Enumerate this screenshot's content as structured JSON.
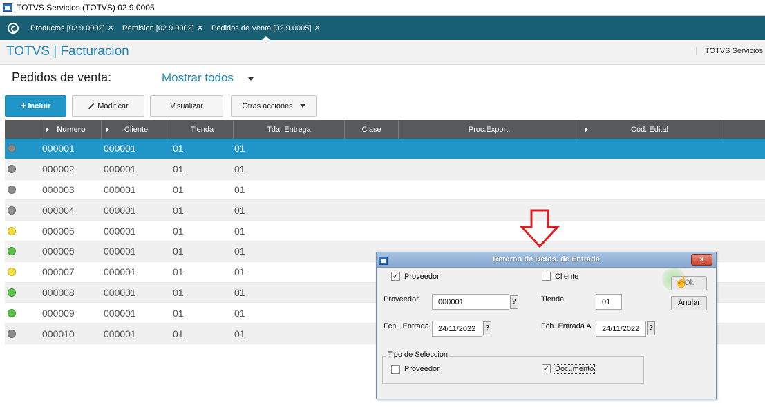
{
  "window": {
    "title": "TOTVS Servicios (TOTVS) 02.9.0005"
  },
  "tabs": [
    {
      "label": "Productos [02.9.0002]",
      "active": false
    },
    {
      "label": "Remision [02.9.0002]",
      "active": false
    },
    {
      "label": "Pedidos de Venta [02.9.0005]",
      "active": true
    }
  ],
  "module": {
    "title": "TOTVS | Facturacion",
    "company": "TOTVS Servicios"
  },
  "page": {
    "title": "Pedidos de venta:",
    "filter": "Mostrar todos"
  },
  "toolbar": {
    "incluir": "Incluir",
    "modificar": "Modificar",
    "visualizar": "Visualizar",
    "otras": "Otras acciones"
  },
  "grid": {
    "columns": [
      "Numero",
      "Cliente",
      "Tienda",
      "Tda. Entrega",
      "Clase",
      "Proc.Export.",
      "Cód. Edital"
    ],
    "rows": [
      {
        "status": "gray",
        "numero": "000001",
        "cliente": "000001",
        "tienda": "01",
        "tda": "01",
        "selected": true
      },
      {
        "status": "gray",
        "numero": "000002",
        "cliente": "000001",
        "tienda": "01",
        "tda": "01"
      },
      {
        "status": "gray",
        "numero": "000003",
        "cliente": "000001",
        "tienda": "01",
        "tda": "01"
      },
      {
        "status": "gray",
        "numero": "000004",
        "cliente": "000001",
        "tienda": "01",
        "tda": "01"
      },
      {
        "status": "yellow",
        "numero": "000005",
        "cliente": "000001",
        "tienda": "01",
        "tda": "01"
      },
      {
        "status": "green",
        "numero": "000006",
        "cliente": "000001",
        "tienda": "01",
        "tda": "01"
      },
      {
        "status": "yellow",
        "numero": "000007",
        "cliente": "000001",
        "tienda": "01",
        "tda": "01"
      },
      {
        "status": "green",
        "numero": "000008",
        "cliente": "000001",
        "tienda": "01",
        "tda": "01"
      },
      {
        "status": "green",
        "numero": "000009",
        "cliente": "000001",
        "tienda": "01",
        "tda": "01"
      },
      {
        "status": "gray",
        "numero": "000010",
        "cliente": "000001",
        "tienda": "01",
        "tda": "01"
      }
    ]
  },
  "status_colors": {
    "gray": "#8c8c8c",
    "yellow": "#f2e03c",
    "green": "#5cc24a"
  },
  "dialog": {
    "title": "Retorno de Dctos. de Entrada",
    "close": "x",
    "chk_proveedor": "Proveedor",
    "chk_cliente": "Cliente",
    "lbl_proveedor": "Proveedor",
    "val_proveedor": "000001",
    "lbl_tienda": "Tienda",
    "val_tienda": "01",
    "lbl_fch_de": "Fch.. Entrada D",
    "val_fch_de": "24/11/2022",
    "lbl_fch_a": "Fch. Entrada A",
    "val_fch_a": "24/11/2022",
    "q": "?",
    "ok": "Ok",
    "anular": "Anular",
    "group": "Tipo de Seleccion",
    "sel_proveedor": "Proveedor",
    "sel_documento": "Documento"
  },
  "accent": "#1f95c8",
  "header_bg": "#195f73",
  "annotation_color": "#e02020"
}
